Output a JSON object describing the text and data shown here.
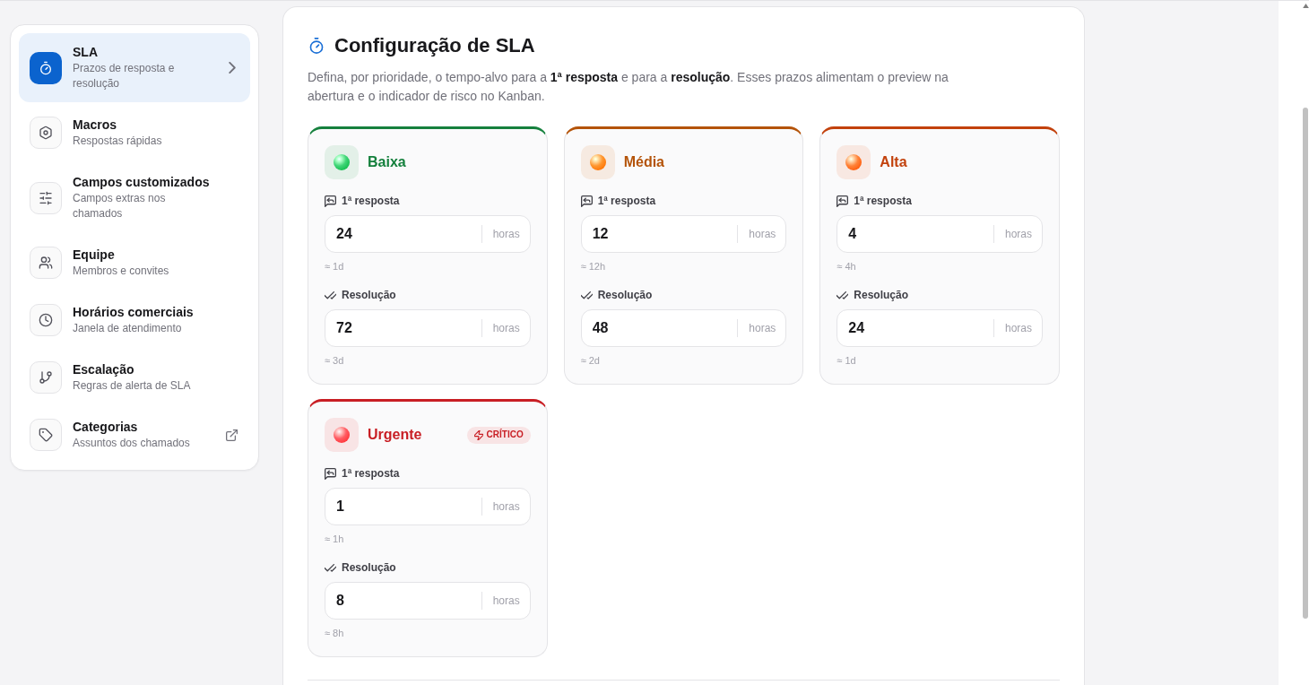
{
  "sidebar": {
    "items": [
      {
        "title": "SLA",
        "subtitle": "Prazos de resposta e resolução",
        "selected": true,
        "external": false
      },
      {
        "title": "Macros",
        "subtitle": "Respostas rápidas",
        "selected": false,
        "external": false
      },
      {
        "title": "Campos customizados",
        "subtitle": "Campos extras nos chamados",
        "selected": false,
        "external": false
      },
      {
        "title": "Equipe",
        "subtitle": "Membros e convites",
        "selected": false,
        "external": false
      },
      {
        "title": "Horários comerciais",
        "subtitle": "Janela de atendimento",
        "selected": false,
        "external": false
      },
      {
        "title": "Escalação",
        "subtitle": "Regras de alerta de SLA",
        "selected": false,
        "external": false
      },
      {
        "title": "Categorias",
        "subtitle": "Assuntos dos chamados",
        "selected": false,
        "external": true
      }
    ]
  },
  "page": {
    "title": "Configuração de SLA",
    "description": "Defina, por prioridade, o tempo-alvo para a **1ª resposta** e para a **resolução**. Esses prazos alimentam o preview na abertura e o indicador de risco no Kanban."
  },
  "priorities": [
    {
      "name": "Baixa",
      "color": "#15803d",
      "targets": [
        {
          "kind": "first_response",
          "label": "1ª resposta",
          "value": "24",
          "unit": "horas",
          "approx": "≈ 1d"
        },
        {
          "kind": "resolution",
          "label": "Resolução",
          "value": "72",
          "unit": "horas",
          "approx": "≈ 3d"
        }
      ]
    },
    {
      "name": "Média",
      "color": "#b45309",
      "targets": [
        {
          "kind": "first_response",
          "label": "1ª resposta",
          "value": "12",
          "unit": "horas",
          "approx": "≈ 12h"
        },
        {
          "kind": "resolution",
          "label": "Resolução",
          "value": "48",
          "unit": "horas",
          "approx": "≈ 2d"
        }
      ]
    },
    {
      "name": "Alta",
      "color": "#c2410c",
      "targets": [
        {
          "kind": "first_response",
          "label": "1ª resposta",
          "value": "4",
          "unit": "horas",
          "approx": "≈ 4h"
        },
        {
          "kind": "resolution",
          "label": "Resolução",
          "value": "24",
          "unit": "horas",
          "approx": "≈ 1d"
        }
      ]
    },
    {
      "name": "Urgente",
      "color": "#c81e24",
      "badge": "CRÍTICO",
      "targets": [
        {
          "kind": "first_response",
          "label": "1ª resposta",
          "value": "1",
          "unit": "horas",
          "approx": "≈ 1h"
        },
        {
          "kind": "resolution",
          "label": "Resolução",
          "value": "8",
          "unit": "horas",
          "approx": "≈ 8h"
        }
      ]
    }
  ]
}
